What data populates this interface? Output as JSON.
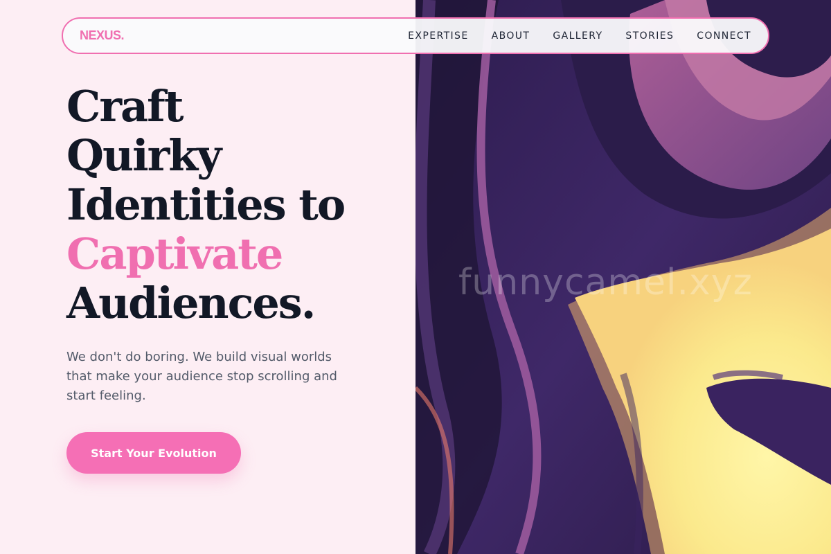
{
  "brand": {
    "logo_text": "NEXUS."
  },
  "nav": {
    "items": [
      {
        "label": "EXPERTISE"
      },
      {
        "label": "ABOUT"
      },
      {
        "label": "GALLERY"
      },
      {
        "label": "STORIES"
      },
      {
        "label": "CONNECT"
      }
    ]
  },
  "hero": {
    "headline_lines": [
      "Craft",
      "Quirky",
      "Identities to",
      "Captivate",
      "Audiences."
    ],
    "highlight_word": "Captivate",
    "subtext": "We don't do boring. We build visual worlds that make your audience stop scrolling and start feeling.",
    "cta_label": "Start Your Evolution"
  },
  "artwork": {
    "watermark_text": "funnycamel.xyz"
  },
  "colors": {
    "accent": "#f06fb0",
    "background": "#fdeef4",
    "heading": "#121826",
    "body_text": "#525a69",
    "art_purple": "#3a2360",
    "art_glow": "#fbf3a0"
  }
}
